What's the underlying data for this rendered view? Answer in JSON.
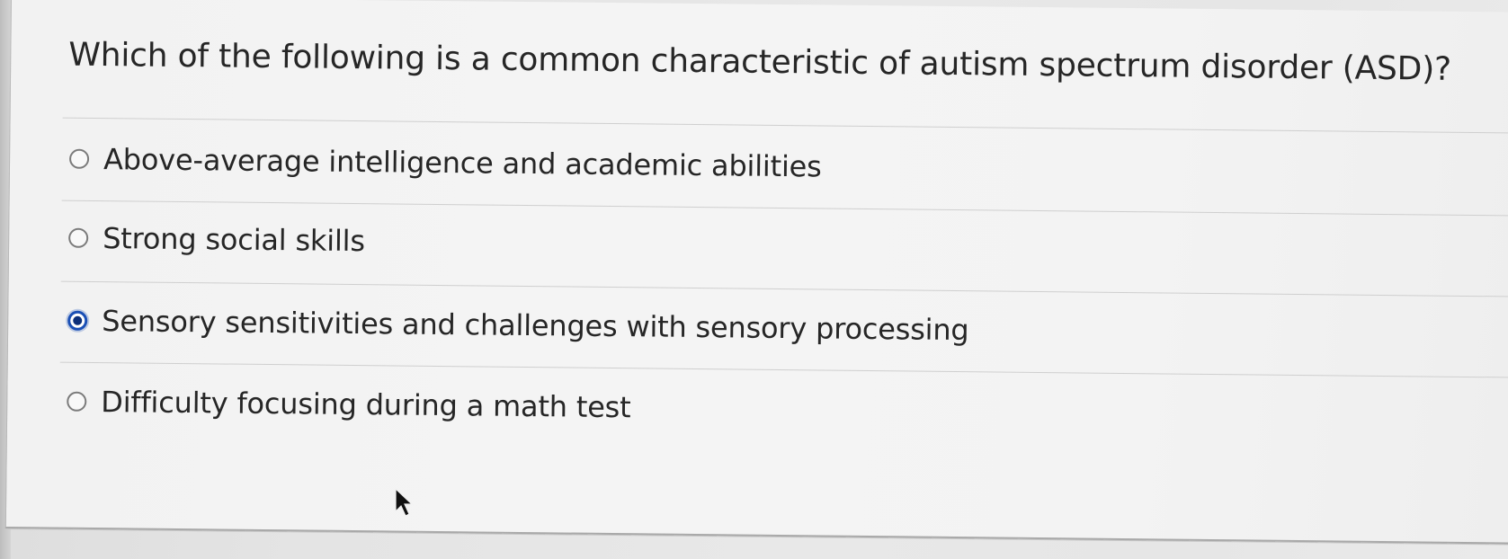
{
  "question": {
    "text": "Which of the following is a common characteristic of autism spectrum disorder (ASD)?"
  },
  "options": [
    {
      "label": "Above-average intelligence and academic abilities",
      "selected": false
    },
    {
      "label": "Strong social skills",
      "selected": false
    },
    {
      "label": "Sensory sensitivities and challenges with sensory processing",
      "selected": true
    },
    {
      "label": "Difficulty focusing during a math test",
      "selected": false
    }
  ],
  "colors": {
    "selected_radio": "#1a4fb5",
    "text": "#262626"
  },
  "icons": {
    "pointer": "mouse-pointer-icon"
  }
}
